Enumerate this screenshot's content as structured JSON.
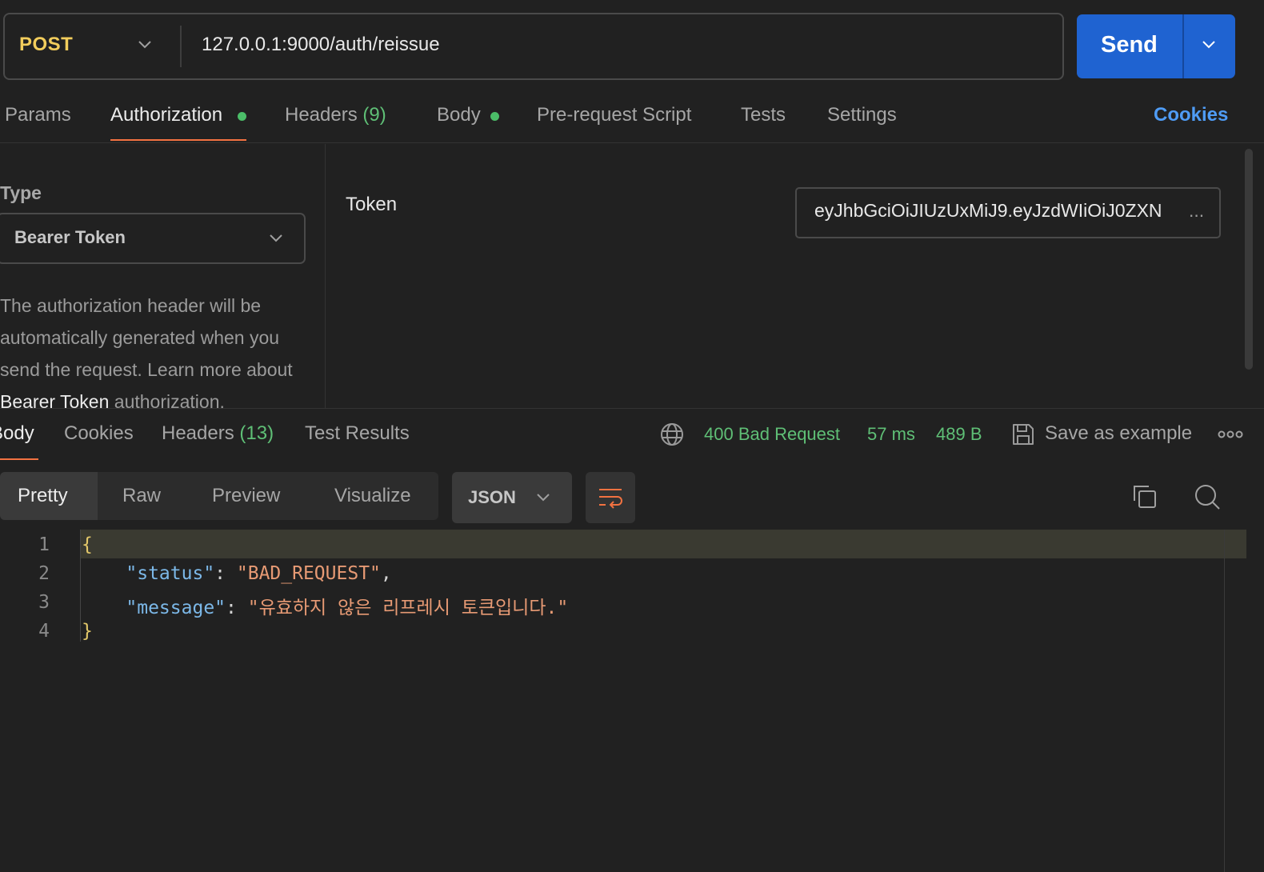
{
  "request": {
    "method": "POST",
    "url": "127.0.0.1:9000/auth/reissue",
    "send_label": "Send"
  },
  "request_tabs": [
    {
      "label": "Params"
    },
    {
      "label": "Authorization",
      "dot": true,
      "active": true
    },
    {
      "label": "Headers",
      "count": "(9)"
    },
    {
      "label": "Body",
      "dot": true
    },
    {
      "label": "Pre-request Script"
    },
    {
      "label": "Tests"
    },
    {
      "label": "Settings"
    }
  ],
  "cookies_link": "Cookies",
  "auth": {
    "type_label": "Type",
    "type_value": "Bearer Token",
    "help_text_1": "The authorization header will be automatically generated when you send the request. Learn more about ",
    "help_link": "Bearer Token",
    "help_text_2": " authorization.",
    "token_label": "Token",
    "token_value": "eyJhbGciOiJIUzUxMiJ9.eyJzdWIiOiJ0ZXN",
    "token_ellipsis": "..."
  },
  "response_tabs": [
    {
      "label": "Body",
      "active": true
    },
    {
      "label": "Cookies"
    },
    {
      "label": "Headers",
      "count": "(13)"
    },
    {
      "label": "Test Results"
    }
  ],
  "response_status": {
    "status": "400 Bad Request",
    "time": "57 ms",
    "size": "489 B",
    "save_label": "Save as example"
  },
  "view_modes": [
    "Pretty",
    "Raw",
    "Preview",
    "Visualize"
  ],
  "active_view": "Pretty",
  "format": "JSON",
  "code": {
    "line_numbers": [
      "1",
      "2",
      "3",
      "4"
    ],
    "open_brace": "{",
    "close_brace": "}",
    "key1": "\"status\"",
    "val1": "\"BAD_REQUEST\"",
    "key2": "\"message\"",
    "val2": "\"유효하지 않은 리프레시 토큰입니다.\""
  },
  "icons": {
    "method_dropdown": "chevron-down-icon",
    "send_dropdown": "chevron-down-icon",
    "type_dropdown": "chevron-down-icon",
    "network": "globe-icon",
    "save": "save-icon",
    "more": "more-icon",
    "wrap": "wrap-icon",
    "copy": "copy-icon",
    "search": "search-icon"
  },
  "colors": {
    "background": "#212121",
    "method": "#f2cd5c",
    "send_button": "#1f63d1",
    "accent_underline": "#f37241",
    "status_ok_dot": "#4bbd68",
    "status_text": "#5fbf76",
    "link": "#4f9cf5"
  }
}
